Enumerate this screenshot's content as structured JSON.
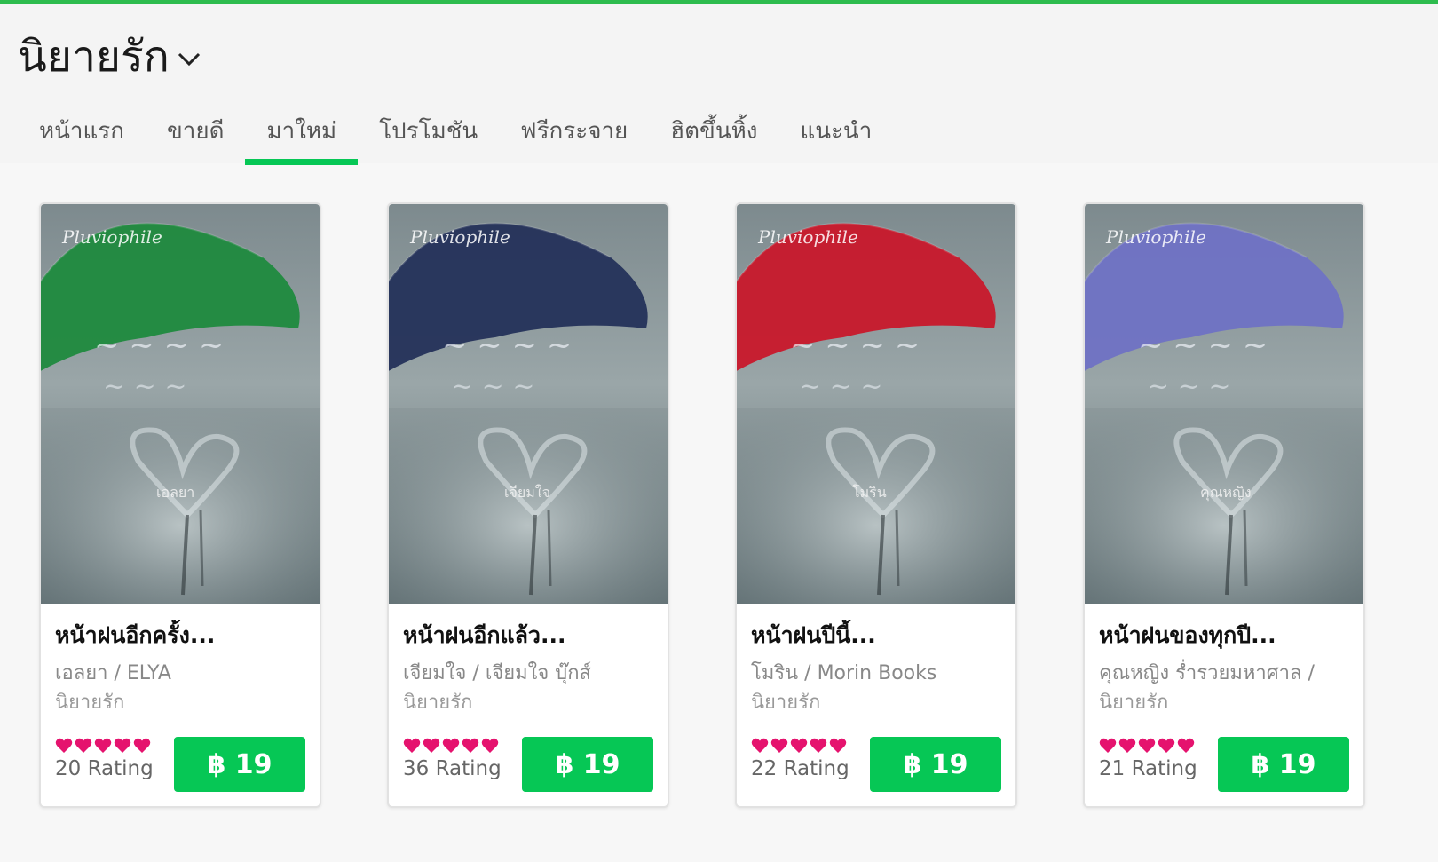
{
  "header": {
    "category_title": "นิยายรัก",
    "tabs": [
      {
        "label": "หน้าแรก"
      },
      {
        "label": "ขายดี"
      },
      {
        "label": "มาใหม่"
      },
      {
        "label": "โปรโมชัน"
      },
      {
        "label": "ฟรีกระจาย"
      },
      {
        "label": "ฮิตขึ้นหิ้ง"
      },
      {
        "label": "แนะนำ"
      }
    ],
    "active_tab": "มาใหม่"
  },
  "colors": {
    "accent": "#06c755",
    "heart": "#e5136e"
  },
  "books": [
    {
      "title": "หน้าฝนอีกครั้ง...",
      "author": "เอลยา / ELYA",
      "genre": "นิยายรัก",
      "stars": 5,
      "rating_text": "20 Rating",
      "price": "฿ 19",
      "cover_author": "เอลยา",
      "umbrella_color": "#1f8a3e"
    },
    {
      "title": "หน้าฝนอีกแล้ว...",
      "author": "เจียมใจ / เจียมใจ บุ๊กส์",
      "genre": "นิยายรัก",
      "stars": 5,
      "rating_text": "36 Rating",
      "price": "฿ 19",
      "cover_author": "เจียมใจ",
      "umbrella_color": "#24325a"
    },
    {
      "title": "หน้าฝนปีนี้...",
      "author": "โมริน / Morin Books",
      "genre": "นิยายรัก",
      "stars": 5,
      "rating_text": "22 Rating",
      "price": "฿ 19",
      "cover_author": "โมริน",
      "umbrella_color": "#c8182b"
    },
    {
      "title": "หน้าฝนของทุกปี...",
      "author": "คุณหญิง ร่ำรวยมหาศาล /",
      "genre": "นิยายรัก",
      "stars": 5,
      "rating_text": "21 Rating",
      "price": "฿ 19",
      "cover_author": "คุณหญิง",
      "umbrella_color": "#6f72c4"
    }
  ],
  "cover_brand": "Pluviophile"
}
